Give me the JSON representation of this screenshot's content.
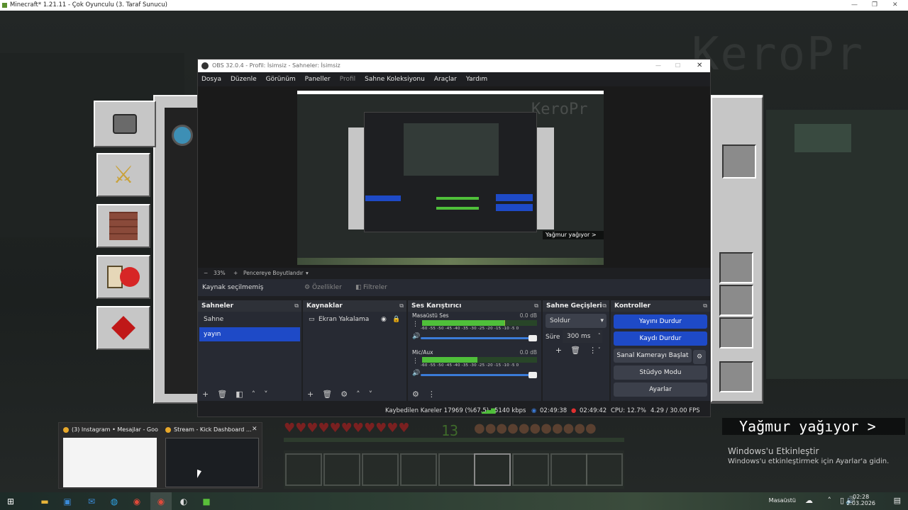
{
  "minecraft": {
    "window_title": "Minecraft* 1.21.11 - Çok Oyunculu (3. Taraf Sunucu)",
    "watermark": "KeroPr",
    "rain_message": "Yağmur yağıyor >",
    "level": "13"
  },
  "windows_activate": {
    "heading": "Windows'u Etkinleştir",
    "subtext": "Windows'u etkinleştirmek için Ayarlar'a gidin."
  },
  "obs": {
    "title": "OBS 32.0.4 - Profil: İsimsiz - Sahneler: İsimsiz",
    "menu": [
      "Dosya",
      "Düzenle",
      "Görünüm",
      "Paneller",
      "Profil",
      "Sahne Koleksiyonu",
      "Araçlar",
      "Yardım"
    ],
    "zoom": "33%",
    "fit_window": "Pencereye Boyutlandır",
    "no_source_selected": "Kaynak seçilmemiş",
    "properties_label": "Özellikler",
    "filters_label": "Filtreler",
    "preview_rain_text": "Yağmur yağıyor >",
    "scenes": {
      "title": "Sahneler",
      "items": [
        "Sahne",
        "yayın"
      ],
      "selected": "yayın"
    },
    "sources": {
      "title": "Kaynaklar",
      "items": [
        "Ekran Yakalama"
      ]
    },
    "mixer": {
      "title": "Ses Karıştırıcı",
      "scale": "-60 -55 -50 -45 -40 -35 -30 -25 -20 -15 -10 -5 0",
      "channels": [
        {
          "name": "Masaüstü Ses",
          "db": "0.0 dB",
          "level": 0.72
        },
        {
          "name": "Mic/Aux",
          "db": "0.0 dB",
          "level": 0.48
        }
      ]
    },
    "transitions": {
      "title": "Sahne Geçişleri",
      "type": "Soldur",
      "duration_label": "Süre",
      "duration_value": "300 ms"
    },
    "controls": {
      "title": "Kontroller",
      "stop_stream": "Yayını Durdur",
      "stop_recording": "Kaydı Durdur",
      "virtual_camera": "Sanal Kamerayı Başlat",
      "studio_mode": "Stüdyo Modu",
      "settings": "Ayarlar"
    },
    "status": {
      "dropped_frames": "Kaybedilen Kareler 17969 (%67.5)",
      "bitrate": "5140 kbps",
      "stream_time": "02:49:38",
      "rec_time": "02:49:42",
      "cpu": "CPU: 12.7%",
      "fps": "4.29 / 30.00 FPS"
    }
  },
  "taskbar": {
    "thumb1_title": "(3) Instagram • Mesajlar - Goog...",
    "thumb2_title": "Stream - Kick Dashboard ...",
    "desktop_label": "Masaüstü",
    "time": "02:28",
    "date": "2.03.2026"
  },
  "colors": {
    "accent": "#1e4ac7",
    "obs_bg": "#272a33",
    "mc_panel": "#c6c6c6"
  }
}
